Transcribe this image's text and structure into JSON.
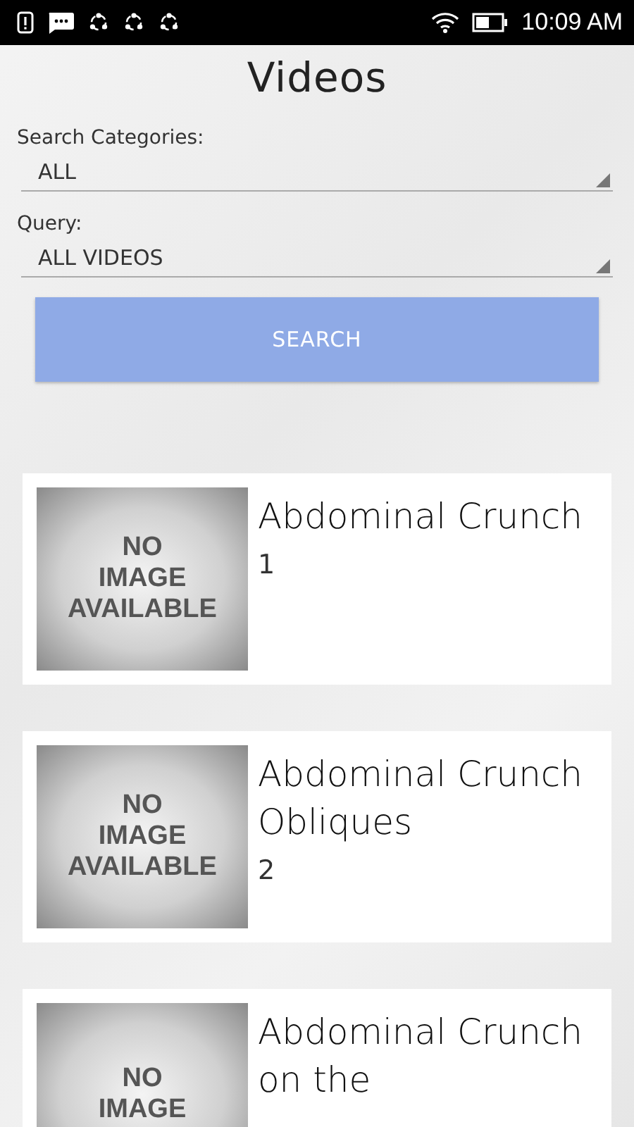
{
  "status_bar": {
    "time": "10:09 AM"
  },
  "title": "Videos",
  "filters": [
    {
      "label": "Search Categories:",
      "value": "ALL"
    },
    {
      "label": "Query:",
      "value": "ALL VIDEOS"
    }
  ],
  "search_button": "SEARCH",
  "videos": [
    {
      "title": "Abdominal Crunch",
      "number": "1",
      "thumbnail_text": [
        "NO",
        "IMAGE",
        "AVAILABLE"
      ]
    },
    {
      "title": "Abdominal Crunch Obliques",
      "number": "2",
      "thumbnail_text": [
        "NO",
        "IMAGE",
        "AVAILABLE"
      ]
    },
    {
      "title": "Abdominal Crunch on the",
      "thumbnail_text": [
        "NO",
        "IMAGE"
      ]
    }
  ]
}
